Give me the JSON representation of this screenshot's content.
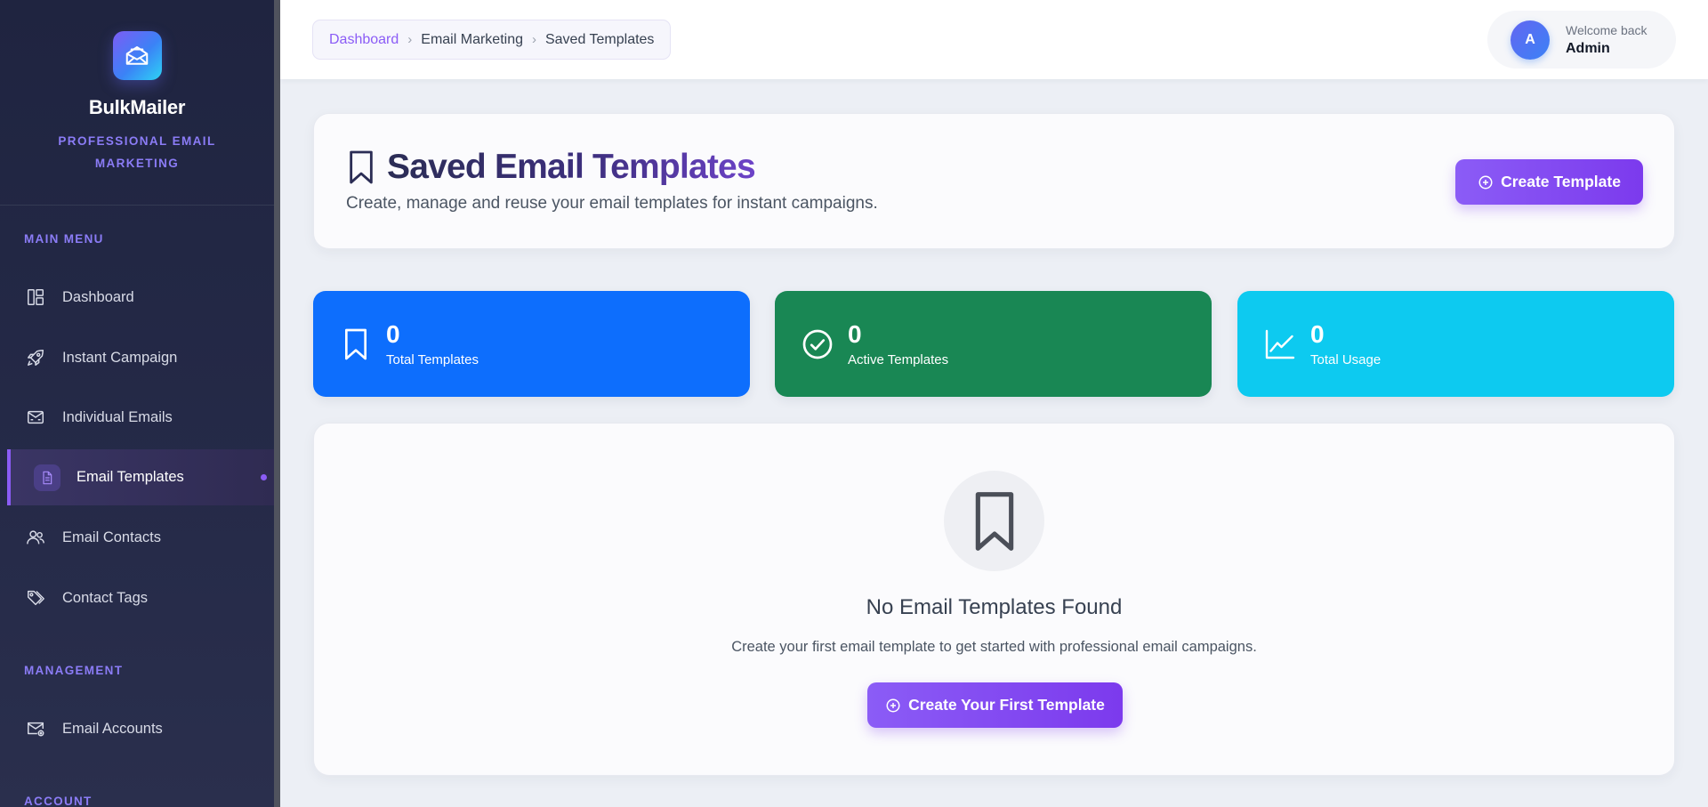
{
  "brand": {
    "name": "BulkMailer",
    "tagline": "PROFESSIONAL EMAIL MARKETING"
  },
  "sidebar": {
    "sections": [
      {
        "title": "MAIN MENU",
        "items": [
          {
            "label": "Dashboard",
            "icon": "dashboard-layout-icon"
          },
          {
            "label": "Instant Campaign",
            "icon": "rocket-icon"
          },
          {
            "label": "Individual Emails",
            "icon": "envelope-send-icon"
          },
          {
            "label": "Email Templates",
            "icon": "template-document-icon",
            "active": true
          },
          {
            "label": "Email Contacts",
            "icon": "people-icon"
          },
          {
            "label": "Contact Tags",
            "icon": "tags-icon"
          }
        ]
      },
      {
        "title": "MANAGEMENT",
        "items": [
          {
            "label": "Email Accounts",
            "icon": "envelope-gear-icon"
          }
        ]
      },
      {
        "title": "ACCOUNT",
        "items": []
      }
    ]
  },
  "breadcrumb": {
    "items": [
      "Dashboard",
      "Email Marketing",
      "Saved Templates"
    ],
    "separator": "›"
  },
  "user": {
    "avatar_initial": "A",
    "welcome": "Welcome back",
    "name": "Admin"
  },
  "header": {
    "title": "Saved Email Templates",
    "subtitle": "Create, manage and reuse your email templates for instant campaigns.",
    "create_button": "Create Template"
  },
  "stats": [
    {
      "value": "0",
      "label": "Total Templates",
      "icon": "bookmark-icon",
      "color": "#0d6efd"
    },
    {
      "value": "0",
      "label": "Active Templates",
      "icon": "check-circle-icon",
      "color": "#198754"
    },
    {
      "value": "0",
      "label": "Total Usage",
      "icon": "line-chart-icon",
      "color": "#0dcaf0"
    }
  ],
  "empty_state": {
    "title": "No Email Templates Found",
    "description": "Create your first email template to get started with professional email campaigns.",
    "button": "Create Your First Template"
  },
  "colors": {
    "accent": "#8b5cf6",
    "sidebar_bg": "#232844",
    "page_bg": "#eceff5"
  }
}
